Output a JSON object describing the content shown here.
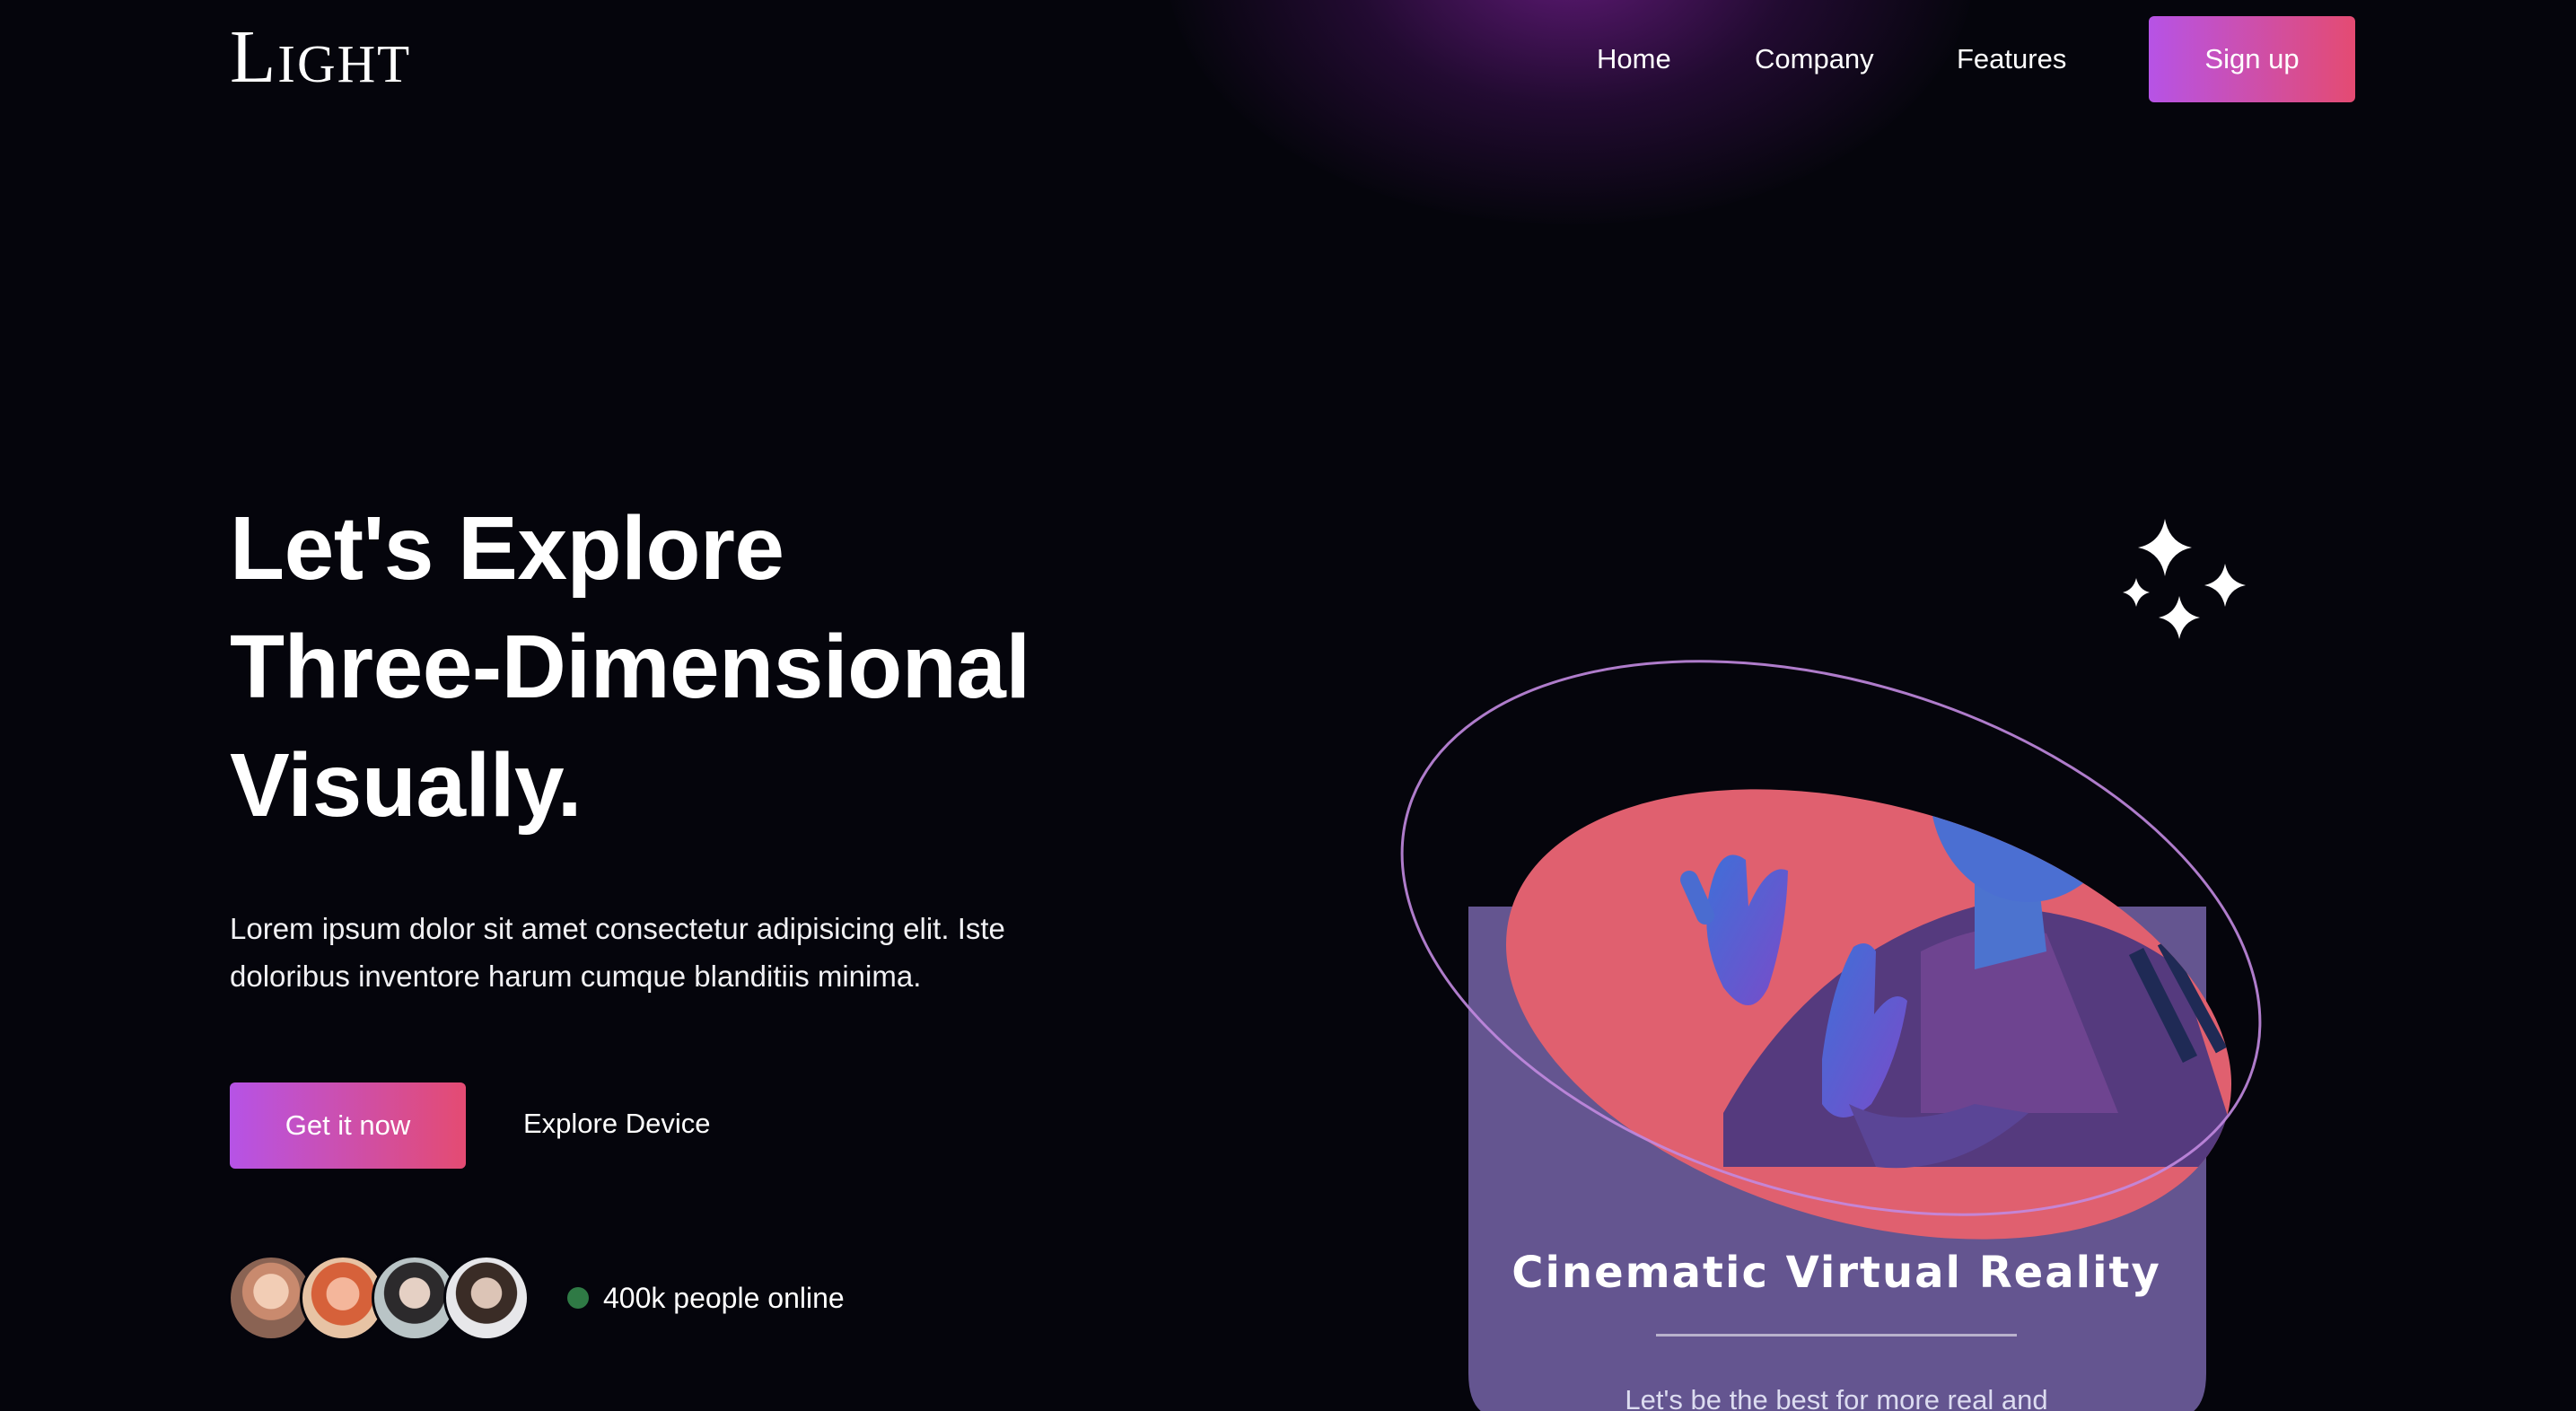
{
  "nav": {
    "logo": "Light",
    "links": [
      "Home",
      "Company",
      "Features"
    ],
    "signup_label": "Sign up"
  },
  "hero": {
    "headline": [
      "Let's Explore",
      "Three-Dimensional",
      "Visually."
    ],
    "description": "Lorem ipsum dolor sit amet consectetur adipisicing elit. Iste doloribus inventore harum cumque blanditiis minima.",
    "primary_cta": "Get it now",
    "secondary_cta": "Explore Device",
    "online_count": "400k people online"
  },
  "card": {
    "title": "Cinematic Virtual Reality",
    "text": "Let's be the best for more real and"
  },
  "colors": {
    "background": "#05050c",
    "gradient_start": "#b653e6",
    "gradient_end": "#e44b72",
    "card_purple": "#645590",
    "card_pink": "#e0606f",
    "online_green": "#2f7a45"
  }
}
